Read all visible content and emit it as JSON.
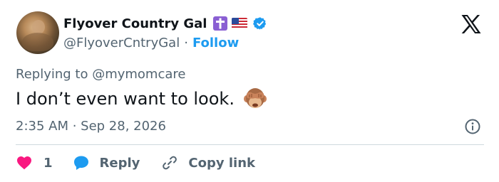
{
  "author": {
    "display_name": "Flyover Country Gal",
    "handle": "@FlyoverCntryGal",
    "separator": "·",
    "follow_label": "Follow",
    "badges": [
      "latin-cross-emoji",
      "us-flag-emoji",
      "verified-badge-icon"
    ]
  },
  "tweet": {
    "replying_to": "Replying to @mymomcare",
    "text": "I don’t even want to look.",
    "emoji": "see-no-evil-monkey",
    "timestamp": "2:35 AM · Sep 28, 2026"
  },
  "actions": {
    "like_count": "1",
    "reply_label": "Reply",
    "copy_link_label": "Copy link"
  },
  "icons": {
    "logo": "x-logo-icon",
    "info": "info-icon",
    "like": "heart-icon",
    "reply": "speech-bubble-icon",
    "copy": "link-icon"
  },
  "colors": {
    "accent": "#1d9bf0",
    "like": "#f91880",
    "text": "#0f1419",
    "secondary": "#536471",
    "divider": "#cfd9de"
  }
}
